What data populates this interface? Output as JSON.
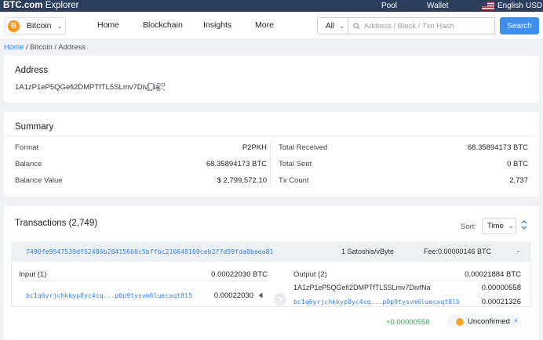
{
  "topbar": {
    "brand_main": "BTC.com",
    "brand_sub": "Explorer",
    "links": [
      "Pool",
      "Wallet"
    ],
    "language": "English",
    "currency": "USD"
  },
  "navbar": {
    "coin": "Bitcoin",
    "items": [
      "Home",
      "Blockchain",
      "Insights",
      "More"
    ],
    "search_scope": "All",
    "search_placeholder": "Address / Block / Txn Hash",
    "search_button": "Search"
  },
  "breadcrumb": [
    "Home",
    "Bitcoin",
    "Address"
  ],
  "breadcrumb_sep": "/",
  "address_card": {
    "title": "Address",
    "address": "1A1zP1eP5QGefi2DMPTfTL5SLmv7DivfNa"
  },
  "summary": {
    "title": "Summary",
    "left": [
      {
        "label": "Format",
        "value": "P2PKH"
      },
      {
        "label": "Balance",
        "value": "68.35894173 BTC"
      },
      {
        "label": "Balance Value",
        "value": "$ 2,799,572.10"
      }
    ],
    "right": [
      {
        "label": "Total Received",
        "value": "68.35894173 BTC"
      },
      {
        "label": "Total Sent",
        "value": "0 BTC"
      },
      {
        "label": "Tx Count",
        "value": "2,737"
      }
    ]
  },
  "transactions": {
    "title": "Transactions (2,749)",
    "sort_label": "Sort:",
    "sort_value": "Time",
    "tx": {
      "hash": "7490fe9547539df52486b284156b0c5bffbc216648169ceb2f7d59fda0baea81",
      "fee_rate": "1 Satoshis/vByte",
      "fee": "Fee:0.00000146 BTC",
      "dash": "-",
      "input_label": "Input (1)",
      "input_total": "0.00022030 BTC",
      "input_address": "bc1q6yrjchkkyp8yc4cq...p0p9tysvm6luecxqt8l5",
      "input_amount": "0.00022030",
      "output_label": "Output (2)",
      "output_total": "0.00021884 BTC",
      "outputs": [
        {
          "address": "1A1zP1eP5QGefi2DMPTfTL5SLmv7DivfNa",
          "amount": "0.00000558"
        },
        {
          "address": "bc1q6yrjchkkyp8yc4cq...p0p9tysvm6luecxqt8l5",
          "amount": "0.00021326"
        }
      ],
      "net_change": "+0.00000558",
      "status": "Unconfirmed"
    }
  },
  "colors": {
    "topbar_bg": "#2d3d5c",
    "link": "#2f80ed",
    "search_button": "#3d8ef0",
    "bitcoin": "#f7931a",
    "positive": "#3aa655",
    "pending": "#f5a623"
  }
}
